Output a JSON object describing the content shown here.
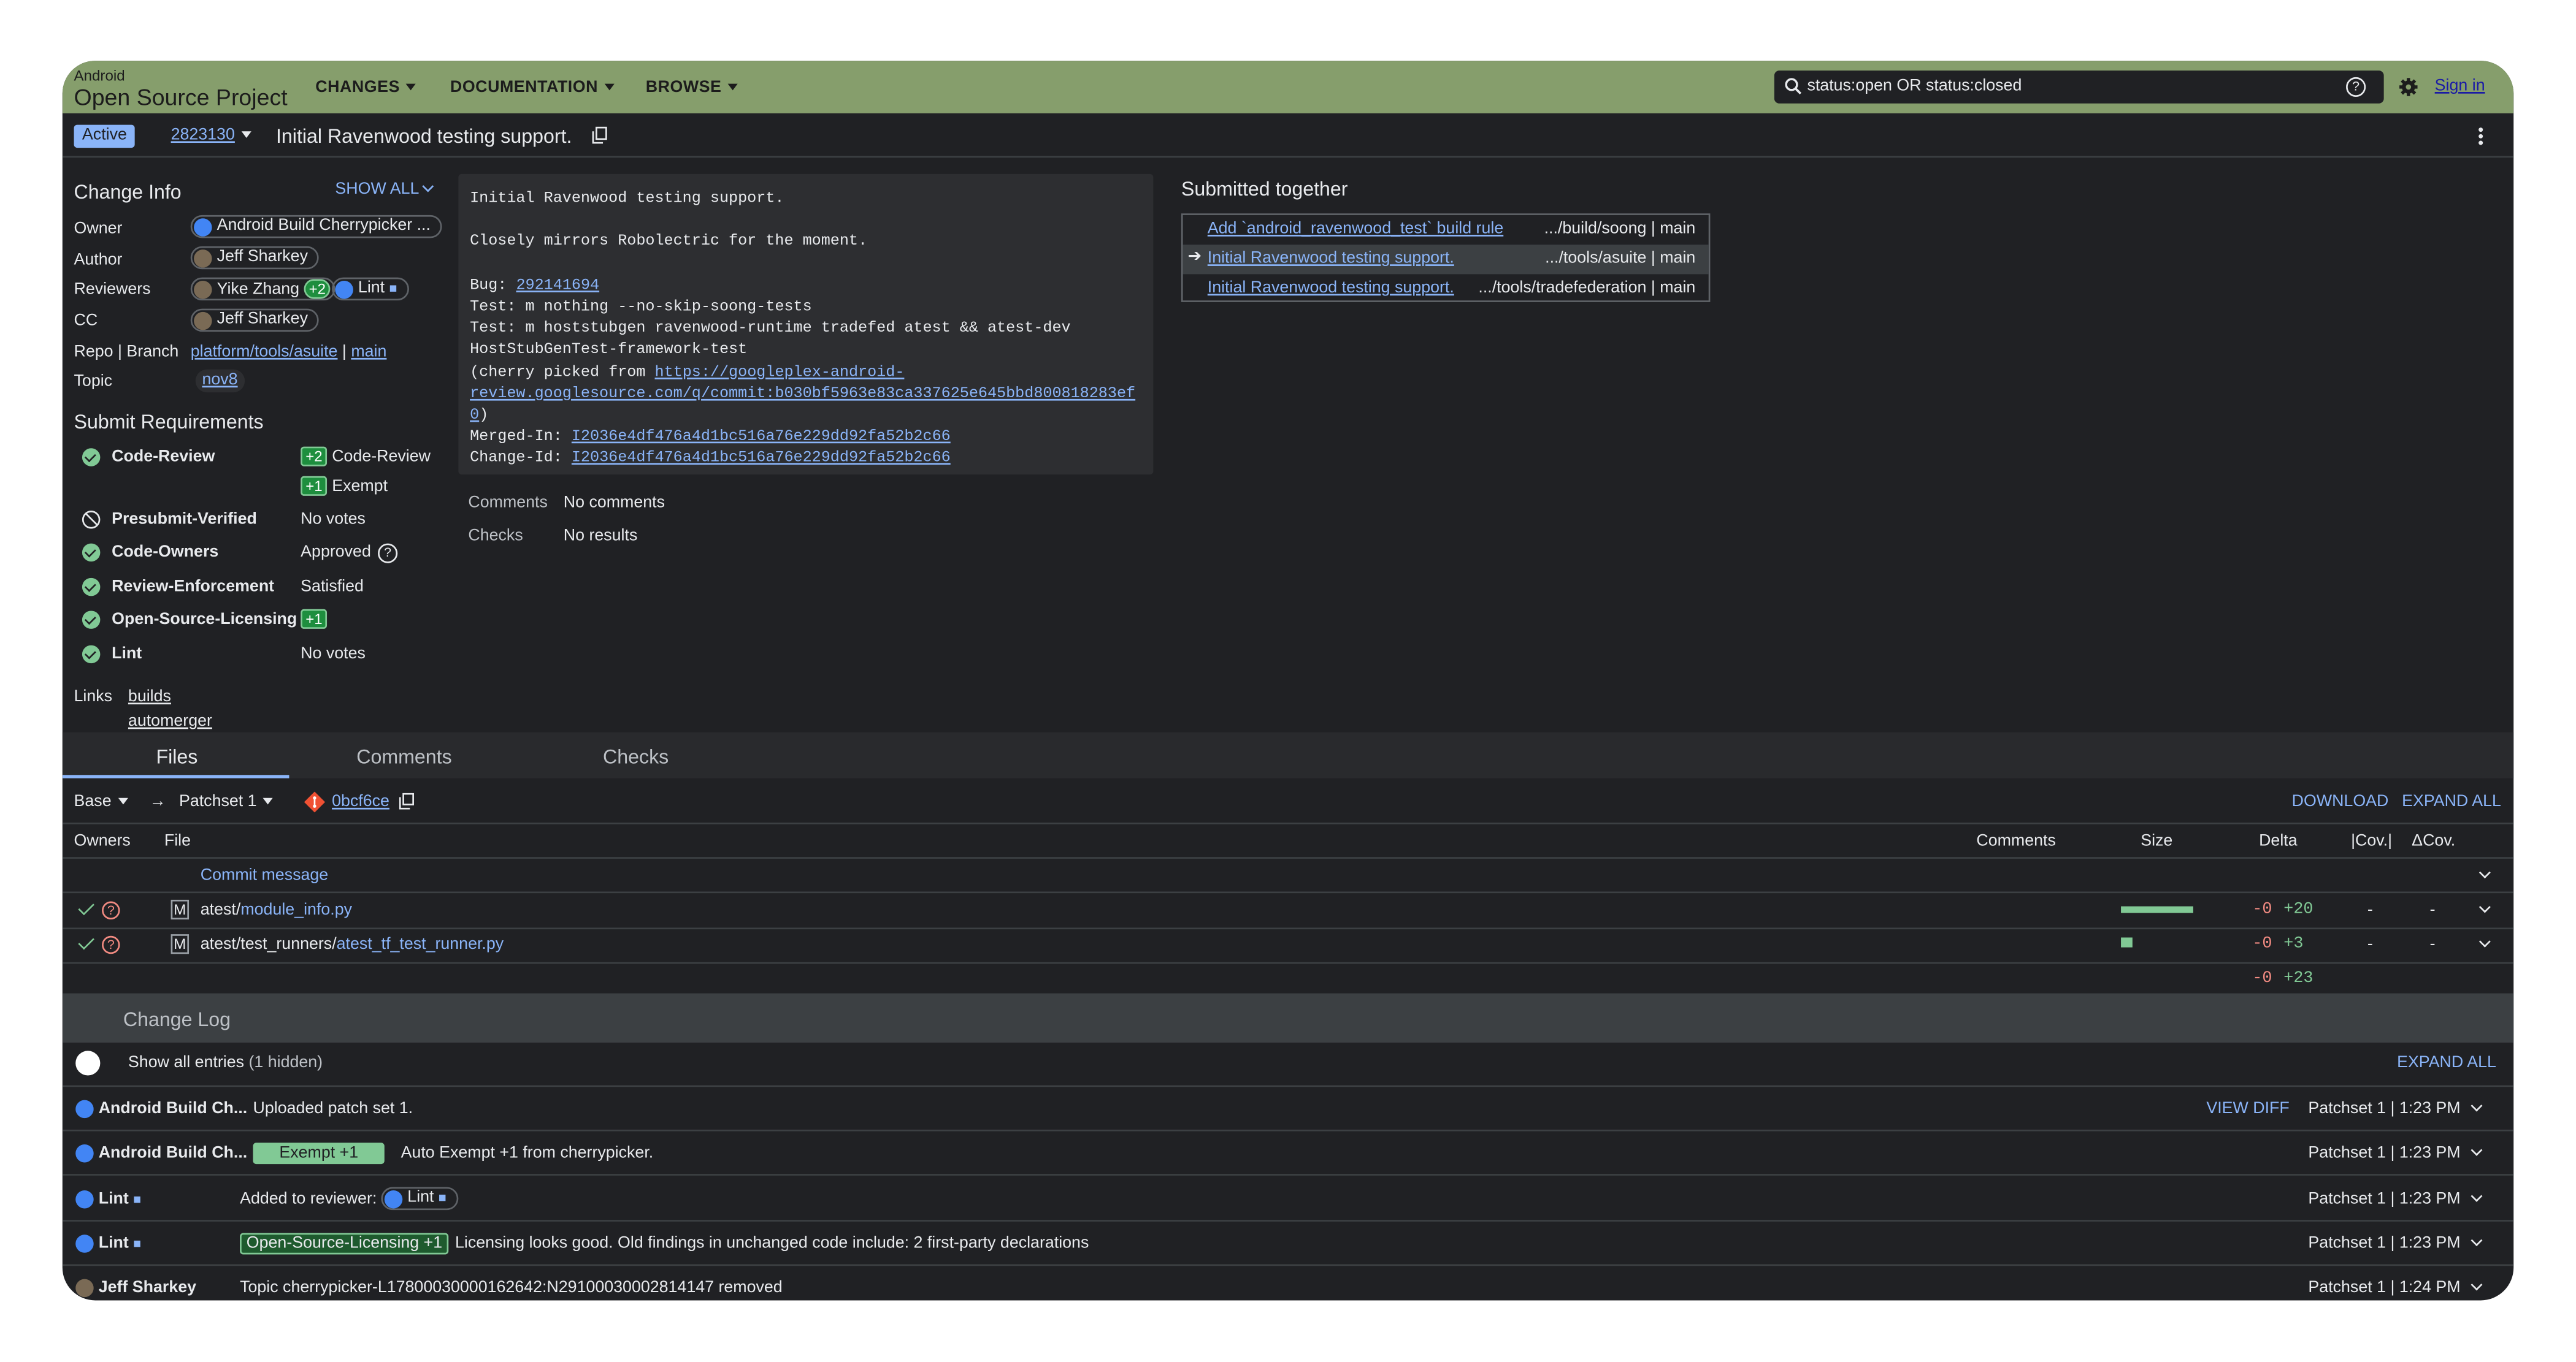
{
  "header": {
    "brand_small": "Android",
    "brand_large": "Open Source Project",
    "nav": [
      "CHANGES",
      "DOCUMENTATION",
      "BROWSE"
    ],
    "search_value": "status:open OR status:closed",
    "sign_in": "Sign in"
  },
  "titlebar": {
    "status": "Active",
    "change_number": "2823130",
    "subject": "Initial Ravenwood testing support."
  },
  "change_info": {
    "title": "Change Info",
    "show_all": "SHOW ALL",
    "owner_label": "Owner",
    "owner": "Android Build Cherrypicker ...",
    "author_label": "Author",
    "author": "Jeff Sharkey",
    "reviewers_label": "Reviewers",
    "reviewer1": "Yike Zhang",
    "reviewer1_vote": "+2",
    "reviewer2": "Lint",
    "cc_label": "CC",
    "cc": "Jeff Sharkey",
    "repo_label": "Repo | Branch",
    "repo": "platform/tools/asuite",
    "sep": "|",
    "branch": "main",
    "topic_label": "Topic",
    "topic": "nov8"
  },
  "submit_requirements": {
    "title": "Submit Requirements",
    "items": [
      {
        "name": "Code-Review",
        "status": "ok",
        "value": "Code-Review",
        "vote": "+2"
      },
      {
        "name": "",
        "status": "",
        "value": "Exempt",
        "vote": "+1"
      },
      {
        "name": "Presubmit-Verified",
        "status": "blocked",
        "value": "No votes"
      },
      {
        "name": "Code-Owners",
        "status": "ok",
        "value": "Approved"
      },
      {
        "name": "Review-Enforcement",
        "status": "ok",
        "value": "Satisfied"
      },
      {
        "name": "Open-Source-Licensing",
        "status": "ok",
        "vote": "+1"
      },
      {
        "name": "Lint",
        "status": "ok",
        "value": "No votes"
      }
    ]
  },
  "links": {
    "label": "Links",
    "items": [
      "builds",
      "automerger"
    ]
  },
  "commit_message": {
    "l1": "Initial Ravenwood testing support.",
    "l2": "Closely mirrors Robolectric for the moment.",
    "bug_label": "Bug: ",
    "bug": "292141694",
    "l4": "Test: m nothing --no-skip-soong-tests",
    "l5": "Test: m hoststubgen ravenwood-runtime tradefed atest && atest-dev",
    "l6": "HostStubGenTest-framework-test",
    "cp_label": "(cherry picked from ",
    "cp_link1": "https://googleplex-android-",
    "cp_link2": "review.googlesource.com/q/commit:b030bf5963e83ca337625e645bbd800818283ef",
    "cp_link3": "0",
    ")": ")",
    "merged_label": "Merged-In: ",
    "merged": "I2036e4df476a4d1bc516a76e229dd92fa52b2c66",
    "changeid_label": "Change-Id: ",
    "changeid": "I2036e4df476a4d1bc516a76e229dd92fa52b2c66"
  },
  "summary": {
    "comments_label": "Comments",
    "comments": "No comments",
    "checks_label": "Checks",
    "checks": "No results"
  },
  "submitted_together": {
    "title": "Submitted together",
    "rows": [
      {
        "arrow": "",
        "subject": "Add `android_ravenwood_test` build rule",
        "path": ".../build/soong | main"
      },
      {
        "arrow": "➔",
        "subject": "Initial Ravenwood testing support.",
        "path": ".../tools/asuite | main"
      },
      {
        "arrow": "",
        "subject": "Initial Ravenwood testing support.",
        "path": ".../tools/tradefederation | main"
      }
    ]
  },
  "tabs": [
    "Files",
    "Comments",
    "Checks"
  ],
  "files": {
    "base": "Base",
    "patchset": "Patchset 1",
    "commit": "0bcf6ce",
    "download": "DOWNLOAD",
    "expand_all": "EXPAND ALL",
    "headers": {
      "owners": "Owners",
      "file": "File",
      "comments": "Comments",
      "size": "Size",
      "delta": "Delta",
      "cov": "|Cov.|",
      "dcov": "ΔCov."
    },
    "commit_message": "Commit message",
    "rows": [
      {
        "status": "M",
        "dir": "atest/",
        "name": "module_info.py",
        "minus": "-0",
        "plus": "+20",
        "cov": "-",
        "dcov": "-",
        "size_fraction": 1.0
      },
      {
        "status": "M",
        "dir": "atest/test_runners/",
        "name": "atest_tf_test_runner.py",
        "minus": "-0",
        "plus": "+3",
        "cov": "-",
        "dcov": "-",
        "size_fraction": 0.15
      }
    ],
    "total_minus": "-0",
    "total_plus": "+23"
  },
  "change_log": {
    "title": "Change Log",
    "show_all": "Show all entries",
    "hidden": "(1 hidden)",
    "expand_all": "EXPAND ALL",
    "view_diff": "VIEW DIFF",
    "entries": [
      {
        "who": "Android Build Ch...",
        "tag": "",
        "msg": "Uploaded patch set 1.",
        "ps": "Patchset 1 | 1:23 PM"
      },
      {
        "who": "Android Build Ch...",
        "tag": "Exempt +1",
        "msg": "Auto Exempt +1 from cherrypicker.",
        "ps": "Patchset 1 | 1:23 PM"
      },
      {
        "who": "Lint",
        "tag": "",
        "msg": "Added to reviewer:",
        "chip": "Lint",
        "ps": "Patchset 1 | 1:23 PM"
      },
      {
        "who": "Lint",
        "tag": "Open-Source-Licensing +1",
        "msg": "Licensing looks good. Old findings in unchanged code include: 2 first-party declarations",
        "ps": "Patchset 1 | 1:23 PM"
      },
      {
        "who": "Jeff Sharkey",
        "tag": "",
        "msg": "Topic cherrypicker-L17800030000162642:N29100030002814147 removed",
        "ps": "Patchset 1 | 1:24 PM"
      }
    ]
  }
}
